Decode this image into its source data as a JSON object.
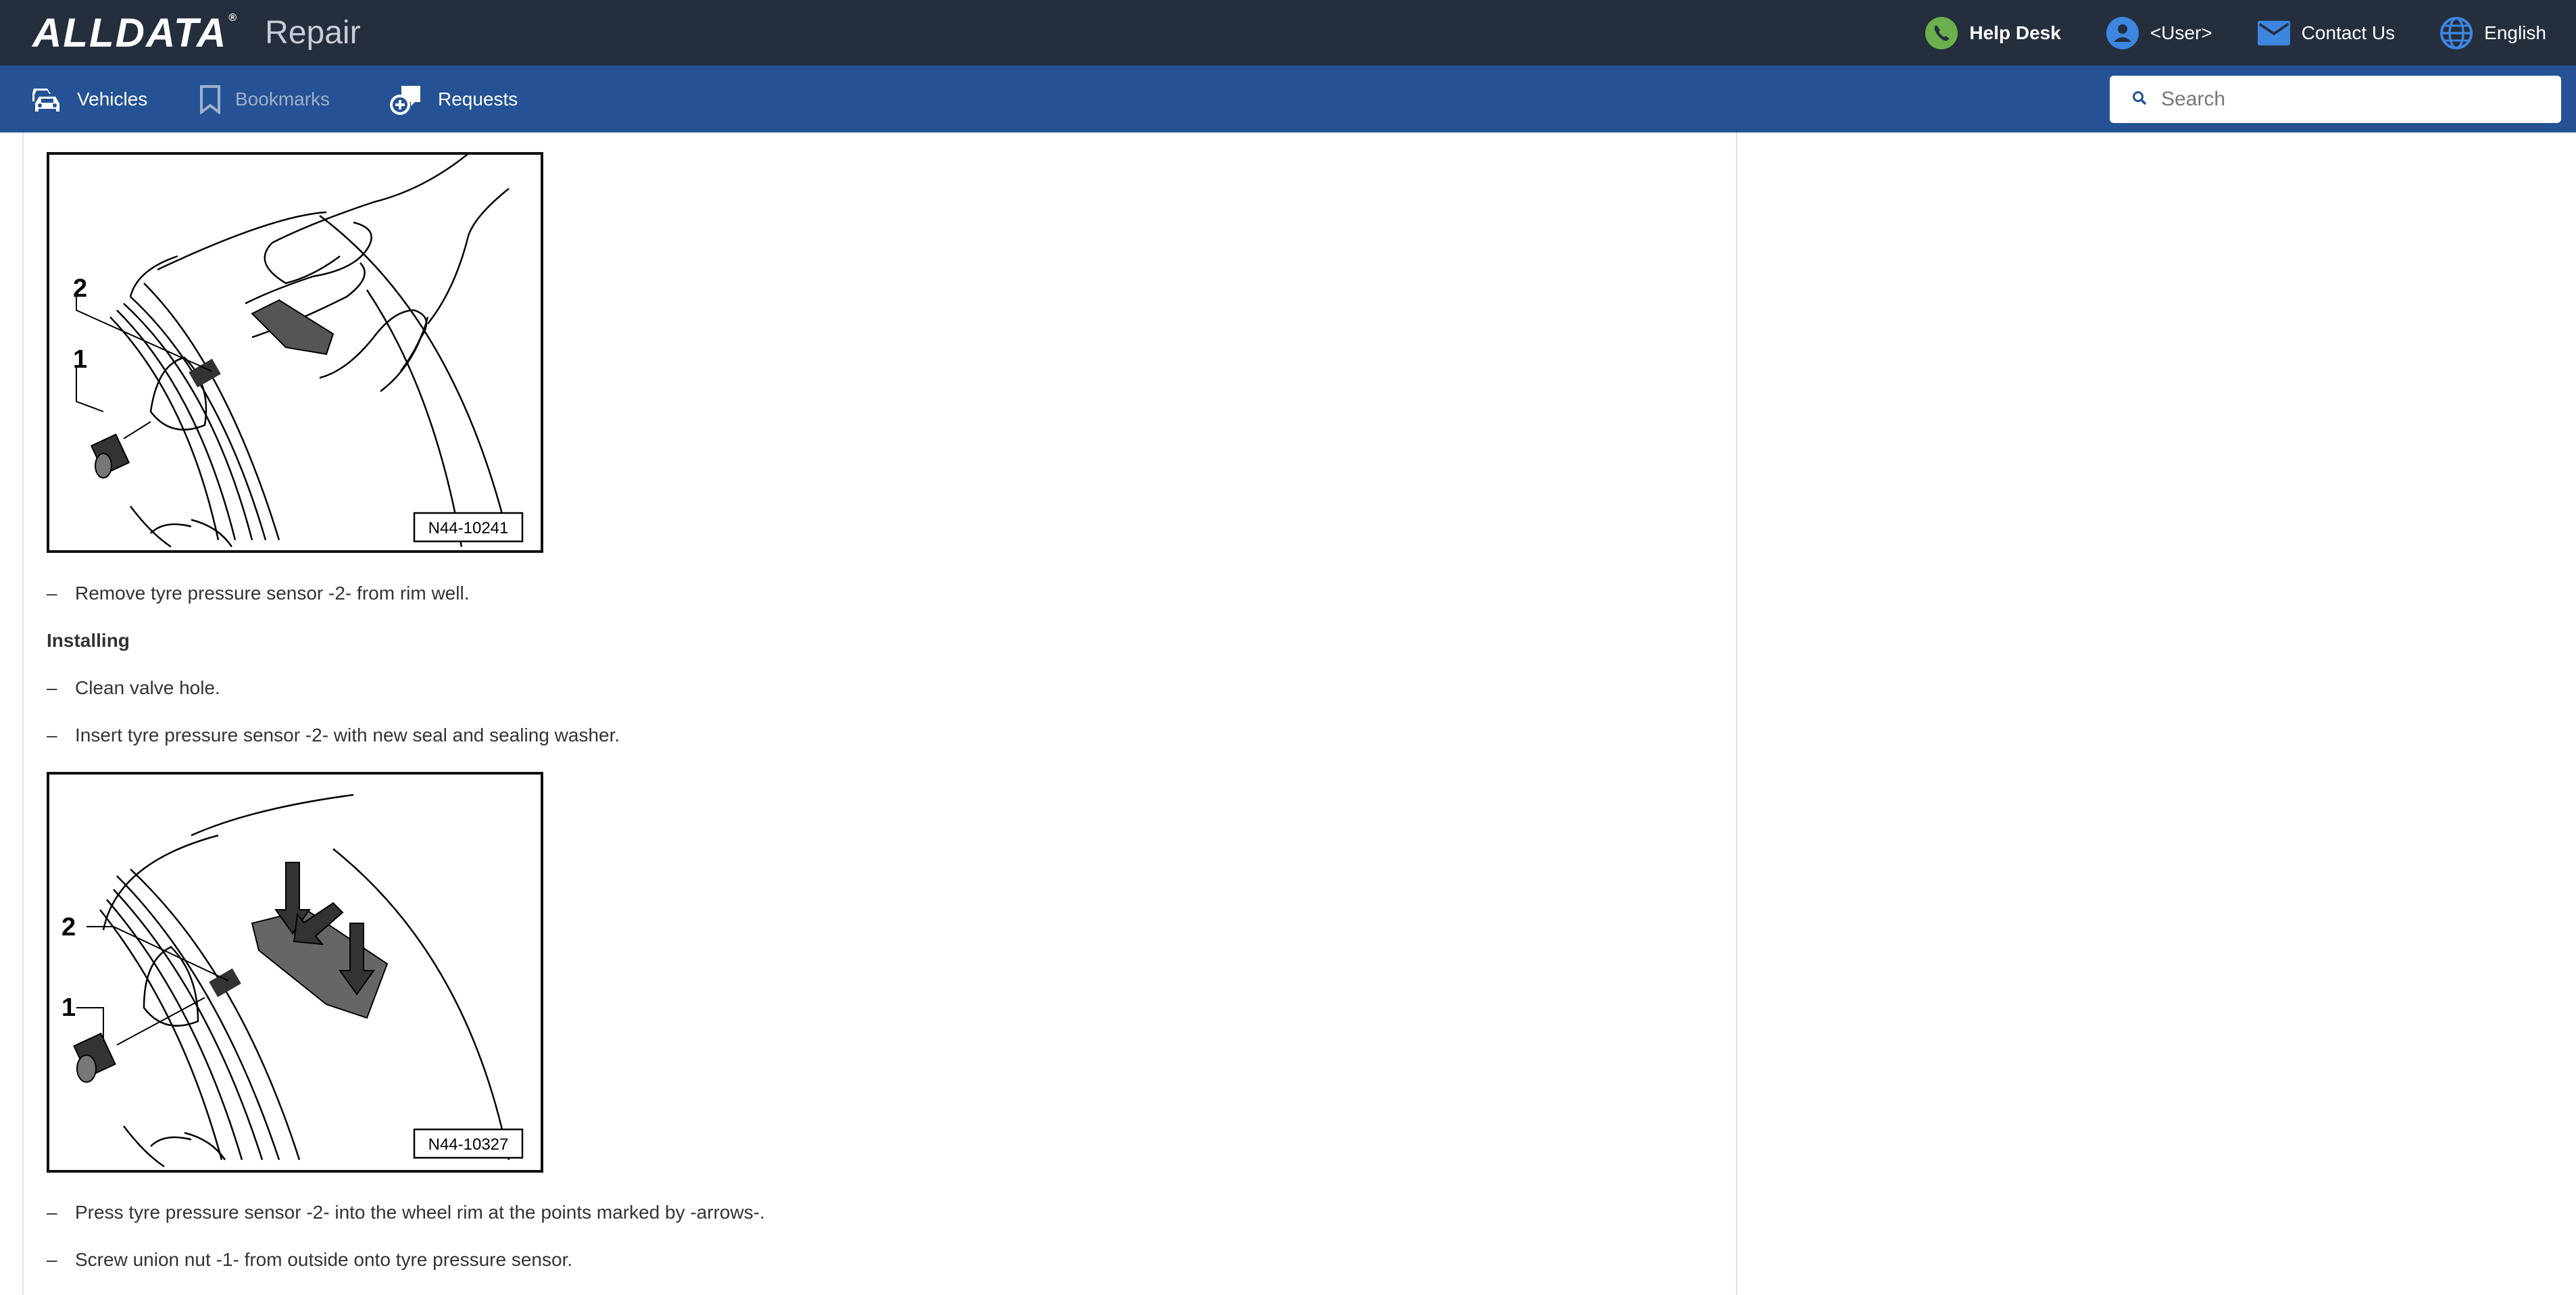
{
  "header": {
    "logo": "ALLDATA",
    "logo_mark": "®",
    "product": "Repair",
    "actions": [
      {
        "label": "Help Desk",
        "icon": "phone-icon"
      },
      {
        "label": "<User>",
        "icon": "user-icon"
      },
      {
        "label": "Contact Us",
        "icon": "mail-icon"
      },
      {
        "label": "English",
        "icon": "globe-icon"
      }
    ]
  },
  "nav": {
    "items": [
      {
        "label": "Vehicles",
        "icon": "car-icon",
        "enabled": true
      },
      {
        "label": "Bookmarks",
        "icon": "bookmark-icon",
        "enabled": false
      },
      {
        "label": "Requests",
        "icon": "request-icon",
        "enabled": true
      }
    ],
    "search_placeholder": "Search"
  },
  "content": {
    "figures": [
      {
        "id": "N44-10241",
        "labels": [
          "2",
          "1"
        ]
      },
      {
        "id": "N44-10327",
        "labels": [
          "2",
          "1"
        ]
      }
    ],
    "step_remove": "Remove tyre pressure sensor -2- from rim well.",
    "heading_installing": "Installing",
    "step_clean": "Clean valve hole.",
    "step_insert": "Insert tyre pressure sensor -2- with new seal and sealing washer.",
    "step_press": "Press tyre pressure sensor -2- into the wheel rim at the points marked by -arrows-.",
    "step_screw": "Screw union nut -1- from outside onto tyre pressure sensor.",
    "dash": "–"
  },
  "colors": {
    "topbar": "#252e3d",
    "navbar": "#245294",
    "help_icon": "#6ab04c",
    "icon_blue": "#3d86e0"
  }
}
